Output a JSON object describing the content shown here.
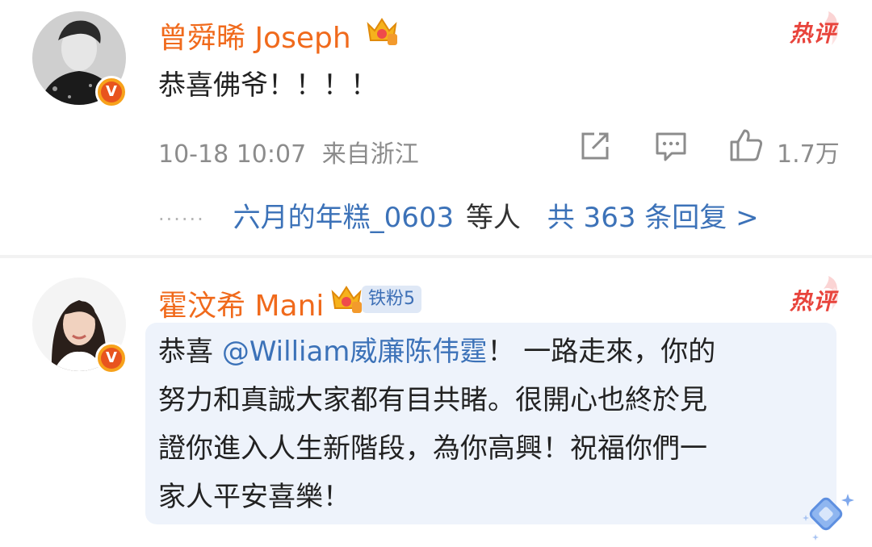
{
  "comments": [
    {
      "username": "曾舜晞 Joseph",
      "hot_label": "热评",
      "text": "恭喜佛爷！！！！",
      "timestamp": "10-18 10:07",
      "location": "来自浙江",
      "like_count": "1.7万",
      "replies": {
        "names": "六月的年糕_0603",
        "suffix": "等人",
        "total": "共 363 条回复 >"
      }
    },
    {
      "username": "霍汶希 Mani",
      "fan_badge": "铁粉5",
      "hot_label": "热评",
      "text_prefix": "恭喜 ",
      "mention": "@William威廉陈伟霆",
      "text_line1_rest": "！ 一路走來，你的",
      "text_line2": "努力和真誠大家都有目共睹。很開心也終於見",
      "text_line3": "證你進入人生新階段，為你高興！祝福你們一",
      "text_line4": "家人平安喜樂！"
    }
  ],
  "colors": {
    "username": "#f06a1c",
    "link": "#3c72b8",
    "hot": "#e8443c",
    "meta": "#8c8c8c",
    "bubble": "#eef3fb"
  },
  "icons": [
    "verified-badge-icon",
    "crown-icon",
    "share-icon",
    "comment-icon",
    "like-icon",
    "sparkle-icon"
  ]
}
